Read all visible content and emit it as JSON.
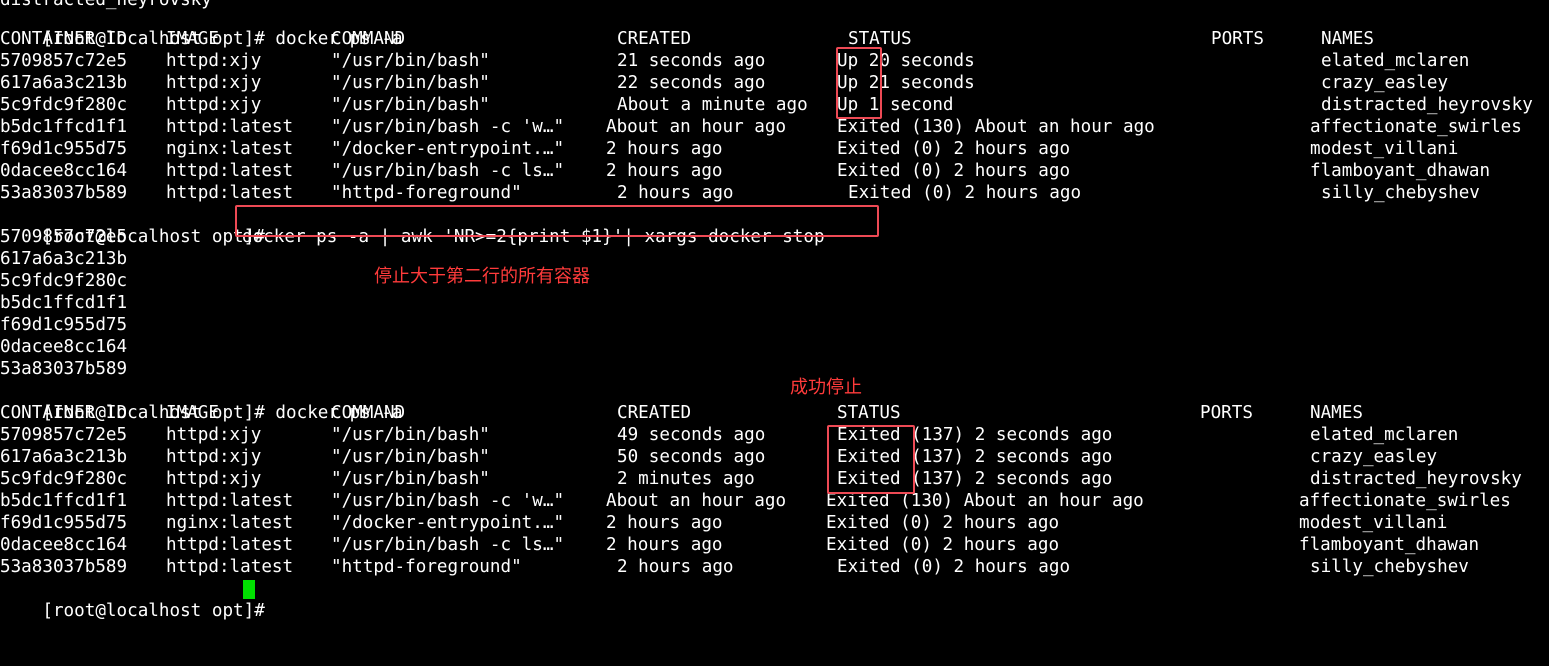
{
  "colors": {
    "background": "#000000",
    "text": "#ffffff",
    "cursor": "#00e000",
    "highlight_box": "#ee4a55",
    "annotation_text": "#ff3b3b"
  },
  "top_fragment": "distracted_heyrovsky",
  "prompt": "[root@localhost opt]#",
  "cmd1": "docker ps -a",
  "headers": [
    "CONTAINER ID",
    "IMAGE",
    "COMMAND",
    "CREATED",
    "STATUS",
    "PORTS",
    "NAMES"
  ],
  "table1": [
    [
      "5709857c72e5",
      "httpd:xjy",
      "\"/usr/bin/bash\"",
      "21 seconds ago",
      "Up 20 seconds",
      "",
      "elated_mclaren"
    ],
    [
      "617a6a3c213b",
      "httpd:xjy",
      "\"/usr/bin/bash\"",
      "22 seconds ago",
      "Up 21 seconds",
      "",
      "crazy_easley"
    ],
    [
      "5c9fdc9f280c",
      "httpd:xjy",
      "\"/usr/bin/bash\"",
      "About a minute ago",
      "Up 1 second",
      "",
      "distracted_heyrovsky"
    ],
    [
      "b5dc1ffcd1f1",
      "httpd:latest",
      "\"/usr/bin/bash -c 'w…\"",
      "About an hour ago",
      "Exited (130) About an hour ago",
      "",
      "affectionate_swirles"
    ],
    [
      "f69d1c955d75",
      "nginx:latest",
      "\"/docker-entrypoint.…\"",
      "2 hours ago",
      "Exited (0) 2 hours ago",
      "",
      "modest_villani"
    ],
    [
      "0dacee8cc164",
      "httpd:latest",
      "\"/usr/bin/bash -c ls…\"",
      "2 hours ago",
      "Exited (0) 2 hours ago",
      "",
      "flamboyant_dhawan"
    ],
    [
      "53a83037b589",
      "httpd:latest",
      "\"httpd-foreground\"",
      "2 hours ago",
      "Exited (0) 2 hours ago",
      "",
      "silly_chebyshev"
    ]
  ],
  "cmd2": "docker ps -a | awk 'NR>=2{print $1}'| xargs docker stop",
  "stopped_ids": [
    "5709857c72e5",
    "617a6a3c213b",
    "5c9fdc9f280c",
    "b5dc1ffcd1f1",
    "f69d1c955d75",
    "0dacee8cc164",
    "53a83037b589"
  ],
  "annotation1": "停止大于第二行的所有容器",
  "cmd3": "docker ps -a",
  "annotation2": "成功停止",
  "table2": [
    [
      "5709857c72e5",
      "httpd:xjy",
      "\"/usr/bin/bash\"",
      "49 seconds ago",
      "Exited (137) 2 seconds ago",
      "",
      "elated_mclaren"
    ],
    [
      "617a6a3c213b",
      "httpd:xjy",
      "\"/usr/bin/bash\"",
      "50 seconds ago",
      "Exited (137) 2 seconds ago",
      "",
      "crazy_easley"
    ],
    [
      "5c9fdc9f280c",
      "httpd:xjy",
      "\"/usr/bin/bash\"",
      "2 minutes ago",
      "Exited (137) 2 seconds ago",
      "",
      "distracted_heyrovsky"
    ],
    [
      "b5dc1ffcd1f1",
      "httpd:latest",
      "\"/usr/bin/bash -c 'w…\"",
      "About an hour ago",
      "Exited (130) About an hour ago",
      "",
      "affectionate_swirles"
    ],
    [
      "f69d1c955d75",
      "nginx:latest",
      "\"/docker-entrypoint.…\"",
      "2 hours ago",
      "Exited (0) 2 hours ago",
      "",
      "modest_villani"
    ],
    [
      "0dacee8cc164",
      "httpd:latest",
      "\"/usr/bin/bash -c ls…\"",
      "2 hours ago",
      "Exited (0) 2 hours ago",
      "",
      "flamboyant_dhawan"
    ],
    [
      "53a83037b589",
      "httpd:latest",
      "\"httpd-foreground\"",
      "2 hours ago",
      "Exited (0) 2 hours ago",
      "",
      "silly_chebyshev"
    ]
  ]
}
